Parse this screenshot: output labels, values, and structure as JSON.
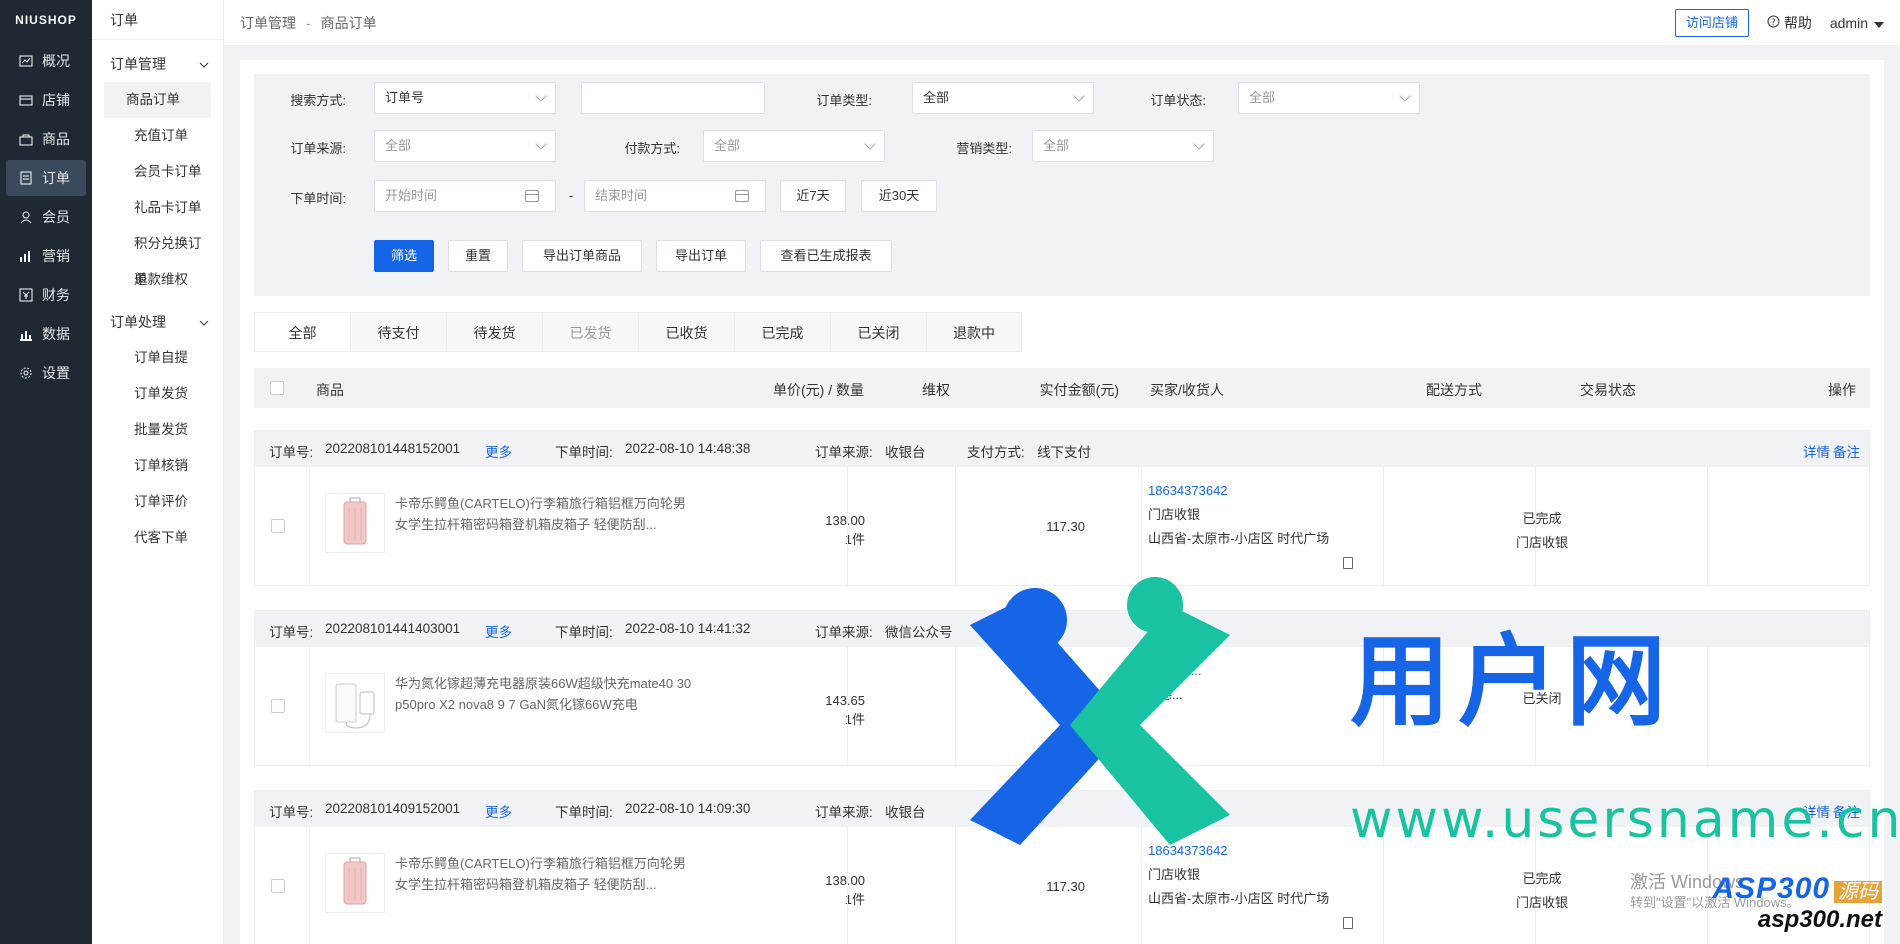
{
  "app": {
    "logo": "NIUSHOP"
  },
  "nav": [
    {
      "label": "概况",
      "icon": "chart-icon"
    },
    {
      "label": "店铺",
      "icon": "store-icon"
    },
    {
      "label": "商品",
      "icon": "bag-icon"
    },
    {
      "label": "订单",
      "icon": "order-icon",
      "active": true
    },
    {
      "label": "会员",
      "icon": "user-icon"
    },
    {
      "label": "营销",
      "icon": "bar-chart-icon"
    },
    {
      "label": "财务",
      "icon": "finance-icon"
    },
    {
      "label": "数据",
      "icon": "data-icon"
    },
    {
      "label": "设置",
      "icon": "gear-icon"
    }
  ],
  "subnav": {
    "title": "订单",
    "group1": {
      "label": "订单管理",
      "items": [
        "商品订单",
        "充值订单",
        "会员卡订单",
        "礼品卡订单",
        "积分兑换订单",
        "退款维权"
      ]
    },
    "group2": {
      "label": "订单处理",
      "items": [
        "订单自提",
        "订单发货",
        "批量发货",
        "订单核销",
        "订单评价",
        "代客下单"
      ]
    }
  },
  "header": {
    "crumb1": "订单管理",
    "crumb_sep": "-",
    "crumb2": "商品订单",
    "visit_store": "访问店铺",
    "help": "帮助",
    "user": "admin"
  },
  "filter": {
    "search_label": "搜索方式:",
    "search_value": "订单号",
    "type_label": "订单类型:",
    "type_value": "全部",
    "status_label": "订单状态:",
    "status_value": "全部",
    "source_label": "订单来源:",
    "source_value": "全部",
    "pay_label": "付款方式:",
    "pay_value": "全部",
    "promo_label": "营销类型:",
    "promo_value": "全部",
    "time_label": "下单时间:",
    "start_placeholder": "开始时间",
    "time_sep": "-",
    "end_placeholder": "结束时间",
    "last7": "近7天",
    "last30": "近30天",
    "btn_filter": "筛选",
    "btn_reset": "重置",
    "btn_export_goods": "导出订单商品",
    "btn_export_order": "导出订单",
    "btn_view_reports": "查看已生成报表"
  },
  "tabs": [
    "全部",
    "待支付",
    "待发货",
    "已发货",
    "已收货",
    "已完成",
    "已关闭",
    "退款中"
  ],
  "table_head": {
    "goods": "商品",
    "price_qty": "单价(元) / 数量",
    "rights": "维权",
    "paid": "实付金额(元)",
    "buyer": "买家/收货人",
    "delivery": "配送方式",
    "trade_status": "交易状态",
    "action": "操作"
  },
  "orders": [
    {
      "order_no_label": "订单号:",
      "order_no": "202208101448152001",
      "more": "更多",
      "time_label": "下单时间:",
      "time": "2022-08-10 14:48:38",
      "source_label": "订单来源:",
      "source": "收银台",
      "pay_label": "支付方式:",
      "pay": "线下支付",
      "detail": "详情",
      "remark": "备注",
      "product": "卡帝乐鳄鱼(CARTELO)行李箱旅行箱铝框万向轮男女学生拉杆箱密码箱登机箱皮箱子 轻便防刮...",
      "price": "138.00",
      "qty": "1件",
      "paid": "117.30",
      "phone": "18634373642",
      "buyer_name": "门店收银",
      "address": "山西省-太原市-小店区 时代广场",
      "status": "已完成",
      "delivery_status": "门店收银"
    },
    {
      "order_no_label": "订单号:",
      "order_no": "202208101441403001",
      "more": "更多",
      "time_label": "下单时间:",
      "time": "2022-08-10 14:41:32",
      "source_label": "订单来源:",
      "source": "微信公众号",
      "product": "华为氮化镓超薄充电器原装66W超级快充mate40 30 p50pro X2 nova8 9 7 GaN氮化镓66W充电",
      "price": "143.65",
      "qty": "1件",
      "phone": "...56afk...",
      "buyer_name": "...德...",
      "status": "已关闭"
    },
    {
      "order_no_label": "订单号:",
      "order_no": "202208101409152001",
      "more": "更多",
      "time_label": "下单时间:",
      "time": "2022-08-10 14:09:30",
      "source_label": "订单来源:",
      "source": "收银台",
      "detail": "详情",
      "remark": "备注",
      "product": "卡帝乐鳄鱼(CARTELO)行李箱旅行箱铝框万向轮男女学生拉杆箱密码箱登机箱皮箱子 轻便防刮...",
      "price": "138.00",
      "qty": "1件",
      "paid": "117.30",
      "phone": "18634373642",
      "buyer_name": "门店收银",
      "address": "山西省-太原市-小店区 时代广场",
      "status": "已完成",
      "delivery_status": "门店收银"
    }
  ],
  "watermark": {
    "brand": "用户网",
    "url": "www.usersname.cn",
    "asp": "ASP300",
    "asp_tag": "源码",
    "asp_url": "asp300.net",
    "win_title": "激活 Windows",
    "win_sub": "转到\"设置\"以激活 Windows。"
  },
  "colors": {
    "primary": "#1565e6",
    "sidebar": "#1f2933",
    "green": "#19c2a0"
  }
}
